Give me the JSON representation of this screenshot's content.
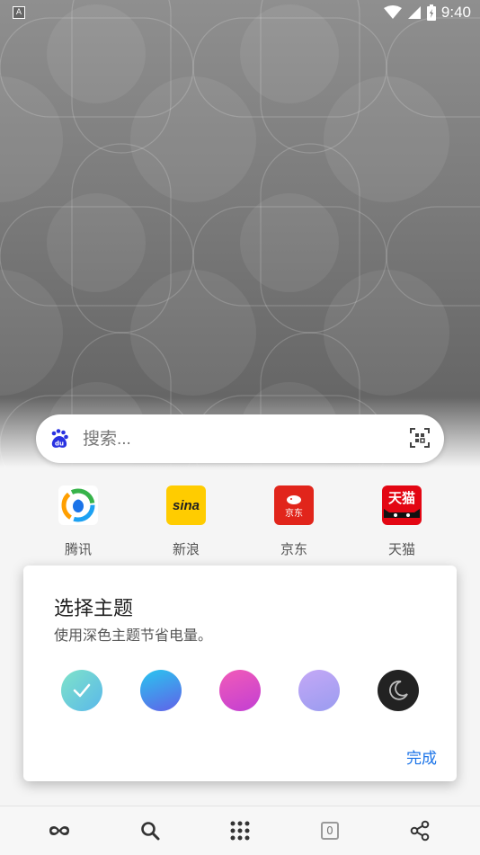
{
  "status_bar": {
    "notification_icon": "A",
    "time": "9:40",
    "icons": [
      "wifi-icon",
      "signal-icon",
      "battery-icon"
    ]
  },
  "search": {
    "placeholder": "搜索..."
  },
  "shortcuts": [
    {
      "label": "腾讯",
      "icon": "tencent-news-logo"
    },
    {
      "label": "新浪",
      "icon": "sina-logo",
      "logo_text": "sina"
    },
    {
      "label": "京东",
      "icon": "jd-logo",
      "logo_text": "京东"
    },
    {
      "label": "天猫",
      "icon": "tmall-logo",
      "logo_text": "天猫"
    }
  ],
  "theme_dialog": {
    "title": "选择主题",
    "subtitle": "使用深色主题节省电量。",
    "done_label": "完成",
    "themes": [
      {
        "name": "teal",
        "selected": true
      },
      {
        "name": "blue",
        "selected": false
      },
      {
        "name": "pink",
        "selected": false
      },
      {
        "name": "purple",
        "selected": false
      },
      {
        "name": "dark",
        "selected": false
      }
    ]
  },
  "bottom_bar": {
    "tab_count": "0",
    "items": [
      "incognito-icon",
      "search-icon",
      "apps-grid-icon",
      "tabs-icon",
      "share-icon"
    ]
  },
  "colors": {
    "accent": "#1a73e8",
    "baidu_blue": "#2932e1",
    "sina_yellow": "#ffcc00",
    "jd_red": "#e1251b",
    "tmall_red": "#e30613"
  }
}
